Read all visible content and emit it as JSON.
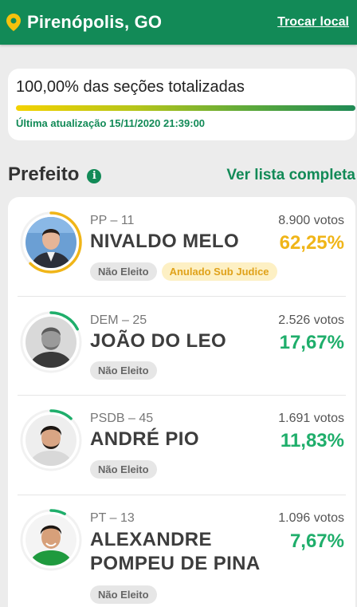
{
  "header": {
    "city": "Pirenópolis, GO",
    "change_label": "Trocar local",
    "pin_icon": "location-pin-icon",
    "color": "#128a57"
  },
  "progress": {
    "title": "100,00% das seções totalizadas",
    "value": 100,
    "updated": "Última atualização 15/11/2020 21:39:00"
  },
  "section": {
    "title": "Prefeito",
    "info_icon": "i",
    "see_all": "Ver lista completa"
  },
  "colors": {
    "leader": "#f0b518",
    "other": "#1fae6b"
  },
  "candidates": [
    {
      "party": "PP – 11",
      "name": "NIVALDO MELO",
      "votes": "8.900 votos",
      "percent": "62,25%",
      "share": 62.25,
      "badge1": "Não Eleito",
      "badge2": "Anulado Sub Judice"
    },
    {
      "party": "DEM – 25",
      "name": "JOÃO DO LEO",
      "votes": "2.526 votos",
      "percent": "17,67%",
      "share": 17.67,
      "badge1": "Não Eleito"
    },
    {
      "party": "PSDB – 45",
      "name": "ANDRÉ PIO",
      "votes": "1.691 votos",
      "percent": "11,83%",
      "share": 11.83,
      "badge1": "Não Eleito"
    },
    {
      "party": "PT – 13",
      "name_line1": "ALEXANDRE",
      "name_line2": "POMPEU DE PINA",
      "votes": "1.096 votos",
      "percent": "7,67%",
      "share": 7.67,
      "badge1": "Não Eleito"
    }
  ]
}
